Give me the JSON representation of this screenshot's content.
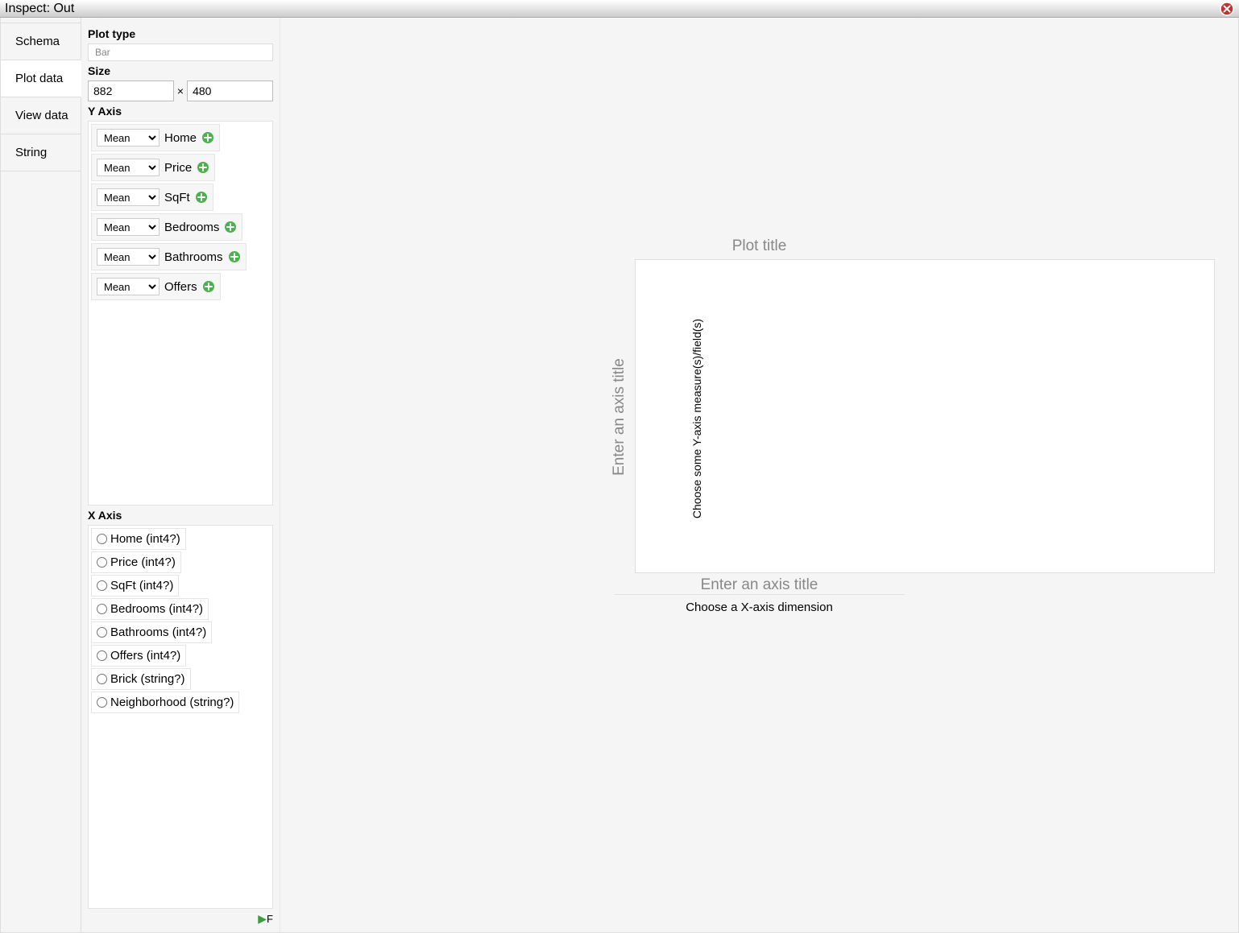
{
  "titlebar": {
    "text": "Inspect: Out"
  },
  "sidebar": {
    "tabs": [
      {
        "label": "Schema"
      },
      {
        "label": "Plot data"
      },
      {
        "label": "View data"
      },
      {
        "label": "String"
      }
    ]
  },
  "config": {
    "plot_type_label": "Plot type",
    "plot_type_value": "Bar",
    "size_label": "Size",
    "size_w": "882",
    "size_h": "480",
    "times": "×",
    "yaxis_label": "Y Axis",
    "y_items": [
      {
        "agg": "Mean",
        "field": "Home"
      },
      {
        "agg": "Mean",
        "field": "Price"
      },
      {
        "agg": "Mean",
        "field": "SqFt"
      },
      {
        "agg": "Mean",
        "field": "Bedrooms"
      },
      {
        "agg": "Mean",
        "field": "Bathrooms"
      },
      {
        "agg": "Mean",
        "field": "Offers"
      }
    ],
    "xaxis_label": "X Axis",
    "x_items": [
      {
        "label": "Home (int4?)"
      },
      {
        "label": "Price (int4?)"
      },
      {
        "label": "SqFt (int4?)"
      },
      {
        "label": "Bedrooms (int4?)"
      },
      {
        "label": "Bathrooms (int4?)"
      },
      {
        "label": "Offers (int4?)"
      },
      {
        "label": "Brick (string?)"
      },
      {
        "label": "Neighborhood (string?)"
      }
    ],
    "footer_f": "F"
  },
  "plot": {
    "title_placeholder": "Plot title",
    "y_hint": "Choose some Y-axis measure(s)/field(s)",
    "axis_title_placeholder": "Enter an axis title",
    "x_hint": "Choose a X-axis dimension"
  }
}
